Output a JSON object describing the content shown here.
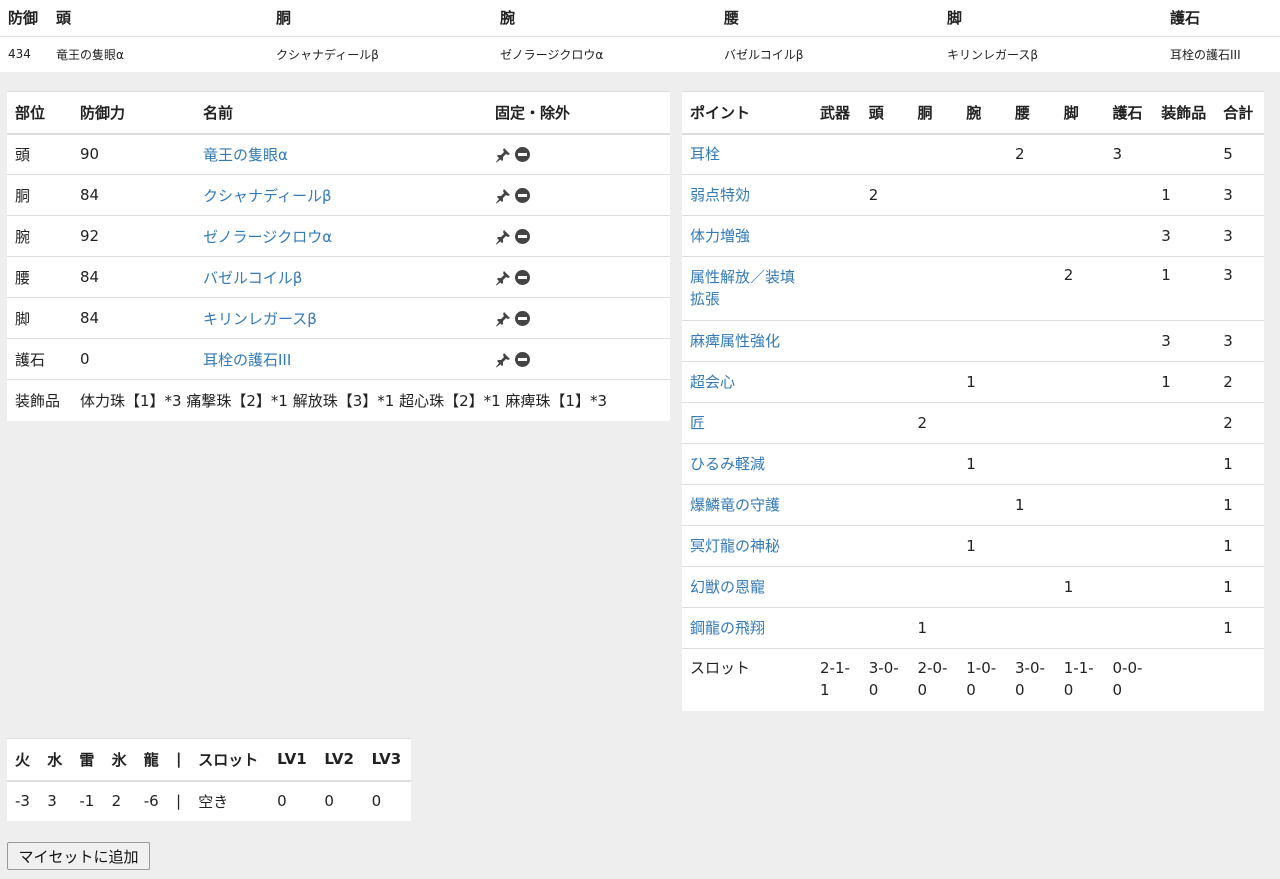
{
  "summary": {
    "headers": [
      "防御",
      "頭",
      "胴",
      "腕",
      "腰",
      "脚",
      "護石"
    ],
    "row": [
      "434",
      "竜王の隻眼α",
      "クシャナディールβ",
      "ゼノラージクロウα",
      "バゼルコイルβ",
      "キリンレガースβ",
      "耳栓の護石III"
    ]
  },
  "equipment": {
    "headers": {
      "part": "部位",
      "defense": "防御力",
      "name": "名前",
      "fix": "固定・除外"
    },
    "rows": [
      {
        "part": "頭",
        "defense": "90",
        "name": "竜王の隻眼α"
      },
      {
        "part": "胴",
        "defense": "84",
        "name": "クシャナディールβ"
      },
      {
        "part": "腕",
        "defense": "92",
        "name": "ゼノラージクロウα"
      },
      {
        "part": "腰",
        "defense": "84",
        "name": "バゼルコイルβ"
      },
      {
        "part": "脚",
        "defense": "84",
        "name": "キリンレガースβ"
      },
      {
        "part": "護石",
        "defense": "0",
        "name": "耳栓の護石III"
      }
    ],
    "decorations_label": "装飾品",
    "decorations": "体力珠【1】*3 痛撃珠【2】*1 解放珠【3】*1 超心珠【2】*1 麻痺珠【1】*3",
    "pin_icon": "pin-icon",
    "exclude_icon": "minus-circle-icon"
  },
  "skills": {
    "headers": [
      "ポイント",
      "武器",
      "頭",
      "胴",
      "腕",
      "腰",
      "脚",
      "護石",
      "装飾品",
      "合計"
    ],
    "rows": [
      {
        "name": "耳栓",
        "cells": [
          "",
          "",
          "",
          "",
          "2",
          "",
          "3",
          "",
          "5"
        ]
      },
      {
        "name": "弱点特効",
        "cells": [
          "",
          "2",
          "",
          "",
          "",
          "",
          "",
          "1",
          "3"
        ]
      },
      {
        "name": "体力増強",
        "cells": [
          "",
          "",
          "",
          "",
          "",
          "",
          "",
          "3",
          "3"
        ]
      },
      {
        "name": "属性解放／装填拡張",
        "cells": [
          "",
          "",
          "",
          "",
          "",
          "2",
          "",
          "1",
          "3"
        ]
      },
      {
        "name": "麻痺属性強化",
        "cells": [
          "",
          "",
          "",
          "",
          "",
          "",
          "",
          "3",
          "3"
        ]
      },
      {
        "name": "超会心",
        "cells": [
          "",
          "",
          "",
          "1",
          "",
          "",
          "",
          "1",
          "2"
        ]
      },
      {
        "name": "匠",
        "cells": [
          "",
          "",
          "2",
          "",
          "",
          "",
          "",
          "",
          "2"
        ]
      },
      {
        "name": "ひるみ軽減",
        "cells": [
          "",
          "",
          "",
          "1",
          "",
          "",
          "",
          "",
          "1"
        ]
      },
      {
        "name": "爆鱗竜の守護",
        "cells": [
          "",
          "",
          "",
          "",
          "1",
          "",
          "",
          "",
          "1"
        ]
      },
      {
        "name": "冥灯龍の神秘",
        "cells": [
          "",
          "",
          "",
          "1",
          "",
          "",
          "",
          "",
          "1"
        ]
      },
      {
        "name": "幻獣の恩寵",
        "cells": [
          "",
          "",
          "",
          "",
          "",
          "1",
          "",
          "",
          "1"
        ]
      },
      {
        "name": "鋼龍の飛翔",
        "cells": [
          "",
          "",
          "1",
          "",
          "",
          "",
          "",
          "",
          "1"
        ]
      }
    ],
    "slot_label": "スロット",
    "slots": [
      "2-1-1",
      "3-0-0",
      "2-0-0",
      "1-0-0",
      "3-0-0",
      "1-1-0",
      "0-0-0",
      "",
      ""
    ]
  },
  "resist": {
    "headers": [
      "火",
      "水",
      "雷",
      "氷",
      "龍",
      "|",
      "スロット",
      "LV1",
      "LV2",
      "LV3"
    ],
    "values": [
      "-3",
      "3",
      "-1",
      "2",
      "-6",
      "|",
      "空き",
      "0",
      "0",
      "0"
    ]
  },
  "add_button": "マイセットに追加"
}
